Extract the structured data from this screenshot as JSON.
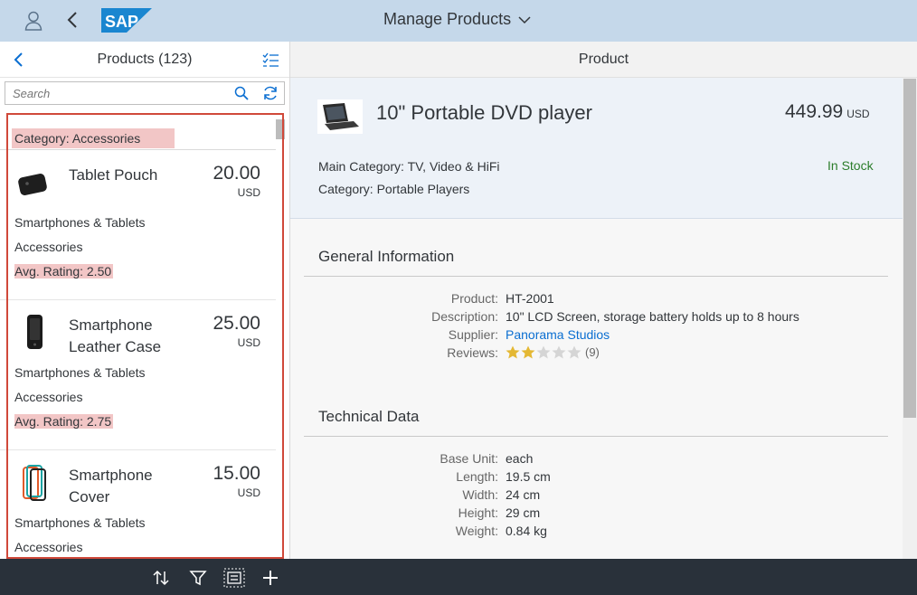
{
  "shell": {
    "title": "Manage Products",
    "logo_text": "SAP",
    "colors": {
      "header_bg": "#c5d8ea",
      "logo_blue": "#1a86d0"
    }
  },
  "master": {
    "title": "Products (123)",
    "search": {
      "placeholder": "Search",
      "value": ""
    },
    "group_header": "Category: Accessories",
    "items": [
      {
        "name": "Tablet Pouch",
        "price": "20.00",
        "currency": "USD",
        "main_category": "Smartphones & Tablets",
        "category": "Accessories",
        "rating": "Avg. Rating: 2.50",
        "thumb_icon": "tablet-pouch-image"
      },
      {
        "name": "Smartphone Leather Case",
        "price": "25.00",
        "currency": "USD",
        "main_category": "Smartphones & Tablets",
        "category": "Accessories",
        "rating": "Avg. Rating: 2.75",
        "thumb_icon": "leather-case-image"
      },
      {
        "name": "Smartphone Cover",
        "price": "15.00",
        "currency": "USD",
        "main_category": "Smartphones & Tablets",
        "category": "Accessories",
        "thumb_icon": "phone-cover-image"
      }
    ],
    "footer_icons": [
      "sort-icon",
      "filter-icon",
      "group-icon",
      "add-icon"
    ]
  },
  "detail": {
    "title": "Product",
    "object": {
      "title": "10\" Portable DVD player",
      "number": "449.99",
      "unit": "USD",
      "main_category": "Main Category: TV, Video & HiFi",
      "category": "Category: Portable Players",
      "status": "In Stock",
      "status_color": "#2b7d2b"
    },
    "general": {
      "title": "General Information",
      "rows": [
        {
          "label": "Product:",
          "value": "HT-2001"
        },
        {
          "label": "Description:",
          "value": "10\" LCD Screen, storage battery holds up to 8 hours"
        },
        {
          "label": "Supplier:",
          "value": "Panorama Studios"
        },
        {
          "label": "Reviews:",
          "value": "(9)"
        }
      ],
      "rating_stars": 2,
      "rating_max": 5
    },
    "technical": {
      "title": "Technical Data",
      "rows": [
        {
          "label": "Base Unit:",
          "value": "each"
        },
        {
          "label": "Length:",
          "value": "19.5 cm"
        },
        {
          "label": "Width:",
          "value": "24 cm"
        },
        {
          "label": "Height:",
          "value": "29 cm"
        },
        {
          "label": "Weight:",
          "value": "0.84 kg"
        }
      ]
    }
  }
}
